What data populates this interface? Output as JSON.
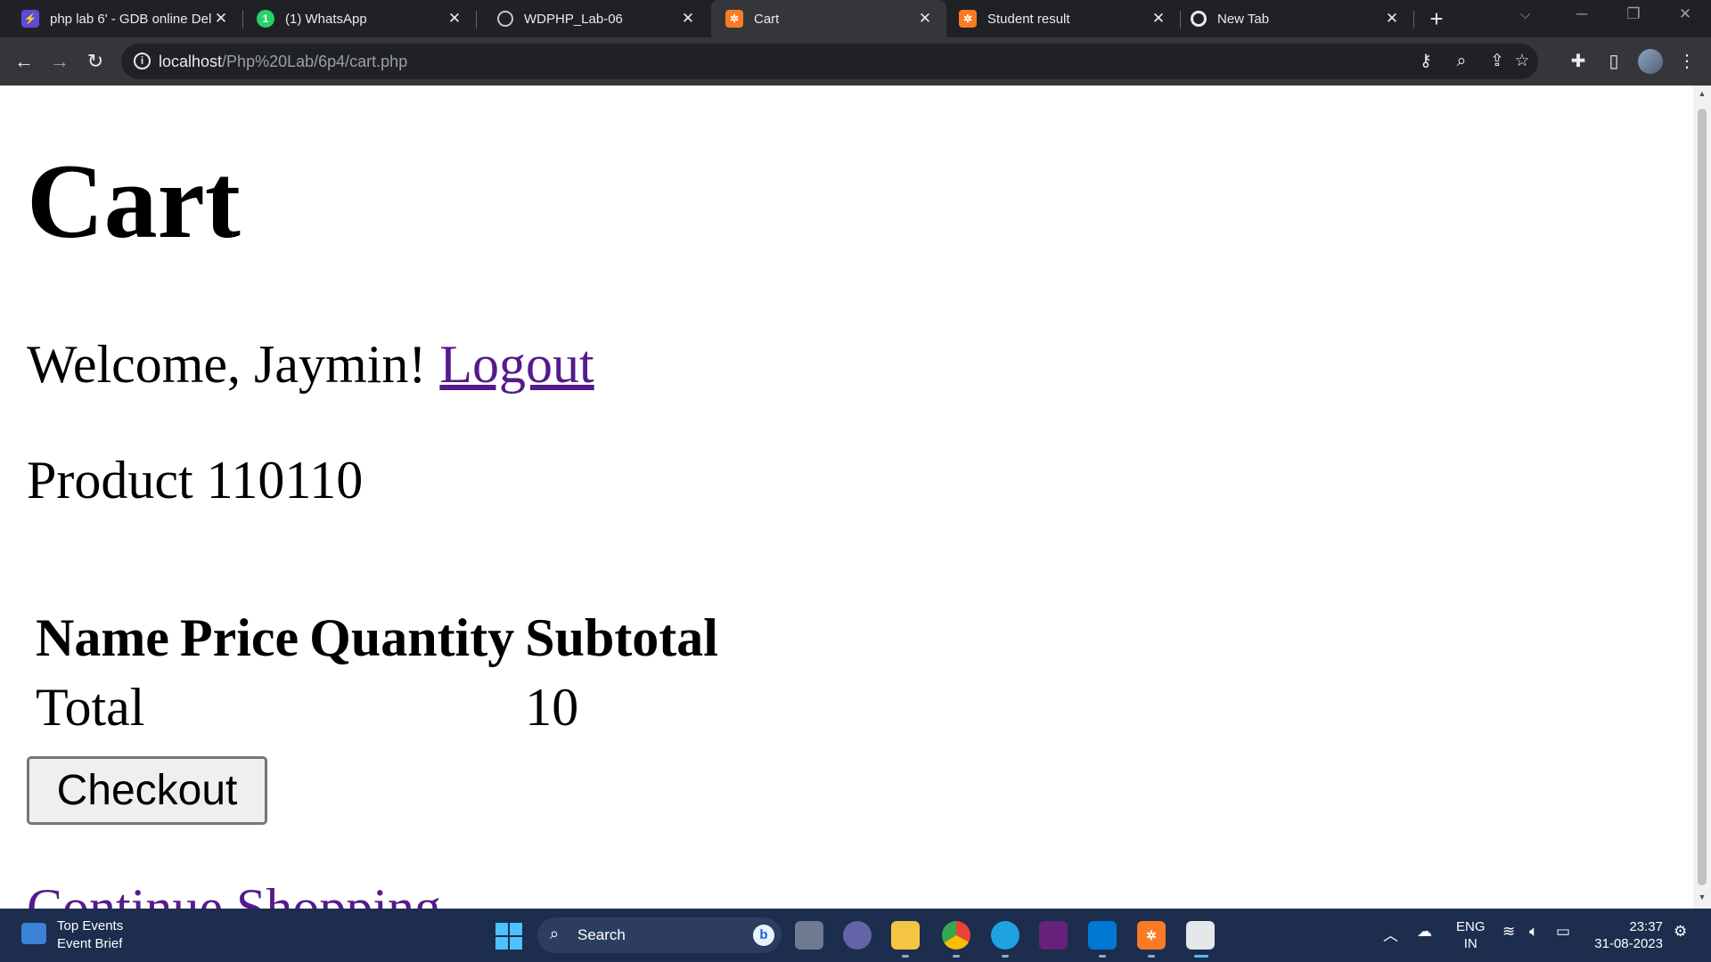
{
  "browser": {
    "tabs": [
      {
        "title": "php lab 6' - GDB online Del"
      },
      {
        "title": "(1) WhatsApp"
      },
      {
        "title": "WDPHP_Lab-06"
      },
      {
        "title": "Cart"
      },
      {
        "title": "Student result"
      },
      {
        "title": "New Tab"
      }
    ],
    "address": {
      "host": "localhost",
      "path": "/Php%20Lab/6p4/cart.php"
    }
  },
  "page": {
    "title": "Cart",
    "welcome_text": "Welcome, Jaymin!",
    "logout_link": "Logout",
    "product_heading": "Product 110110",
    "table": {
      "headers": [
        "Name",
        "Price",
        "Quantity",
        "Subtotal"
      ],
      "total_label": "Total",
      "total_value": "10"
    },
    "checkout_button": "Checkout",
    "continue_link": "Continue Shopping"
  },
  "taskbar": {
    "widget_title": "Top Events",
    "widget_subtitle": "Event Brief",
    "search_label": "Search",
    "language": "ENG",
    "region": "IN",
    "time": "23:37",
    "date": "31-08-2023"
  },
  "colors": {
    "link": "#551a8b",
    "chrome_dark": "#202124",
    "chrome_toolbar": "#35363a",
    "taskbar": "#1c2d4e"
  },
  "icons": [
    "back-icon",
    "forward-icon",
    "reload-icon",
    "info-icon",
    "key-icon",
    "zoom-icon",
    "share-icon",
    "star-icon",
    "extensions-icon",
    "side-panel-icon",
    "menu-icon",
    "search-icon",
    "wifi-icon",
    "volume-icon",
    "battery-icon"
  ]
}
